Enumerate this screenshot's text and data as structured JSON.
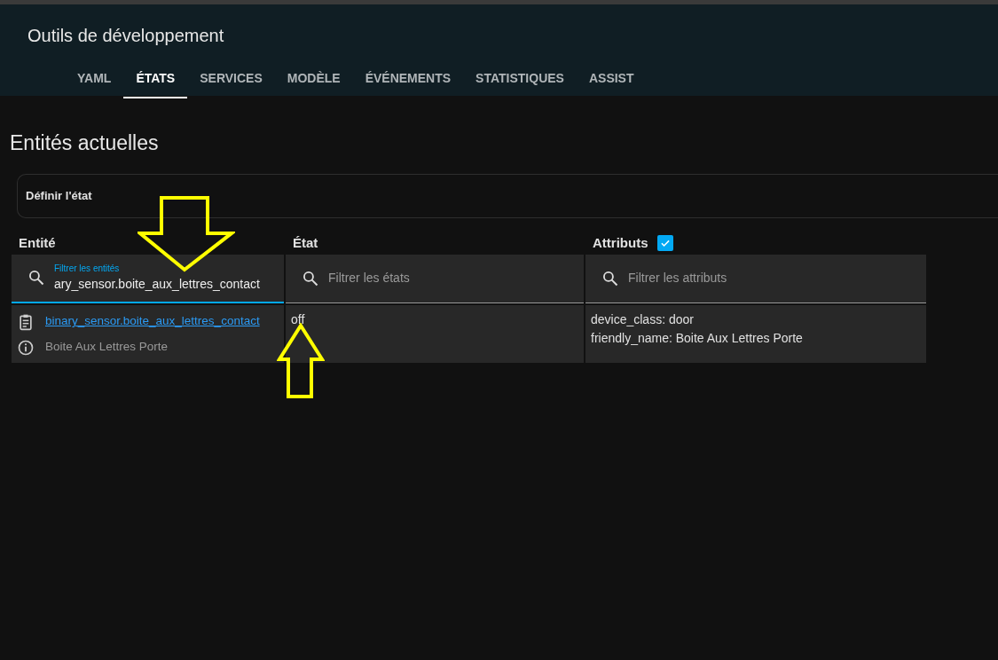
{
  "window": {
    "title": "Outils de développement"
  },
  "tabs": [
    {
      "label": "YAML",
      "selected": false
    },
    {
      "label": "ÉTATS",
      "selected": true
    },
    {
      "label": "SERVICES",
      "selected": false
    },
    {
      "label": "MODÈLE",
      "selected": false
    },
    {
      "label": "ÉVÉNEMENTS",
      "selected": false
    },
    {
      "label": "STATISTIQUES",
      "selected": false
    },
    {
      "label": "ASSIST",
      "selected": false
    }
  ],
  "section_title": "Entités actuelles",
  "set_state_panel": {
    "title": "Définir l'état"
  },
  "table": {
    "columns": [
      {
        "label": "Entité",
        "filter": {
          "placeholder": "Filtrer les entités",
          "value": "ary_sensor.boite_aux_lettres_contact",
          "focused": true
        }
      },
      {
        "label": "État",
        "filter": {
          "placeholder": "Filtrer les états",
          "focused": false
        }
      },
      {
        "label": "Attributs",
        "checkbox": {
          "checked": true
        },
        "filter": {
          "placeholder": "Filtrer les attributs",
          "focused": false
        }
      }
    ],
    "rows": [
      {
        "entity_id": "binary_sensor.boite_aux_lettres_contact",
        "friendly_name": "Boite Aux Lettres Porte",
        "state": "off",
        "attributes": [
          "device_class: door",
          "friendly_name: Boite Aux Lettres Porte"
        ]
      }
    ]
  }
}
